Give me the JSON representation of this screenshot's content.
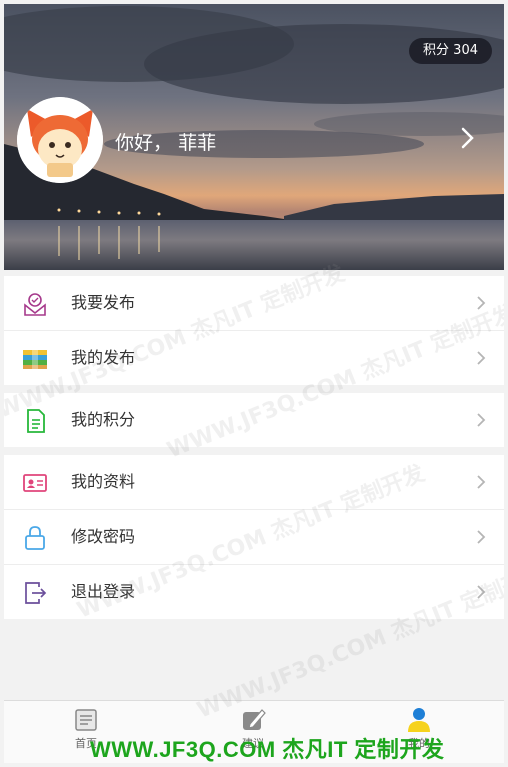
{
  "header": {
    "points_label": "积分 304",
    "greeting": "你好，",
    "username": "菲菲"
  },
  "menu_groups": [
    [
      {
        "label": "我要发布",
        "icon": "post-icon"
      },
      {
        "label": "我的发布",
        "icon": "books-icon"
      }
    ],
    [
      {
        "label": "我的积分",
        "icon": "document-icon"
      }
    ],
    [
      {
        "label": "我的资料",
        "icon": "id-card-icon"
      },
      {
        "label": "修改密码",
        "icon": "lock-icon"
      },
      {
        "label": "退出登录",
        "icon": "logout-icon"
      }
    ]
  ],
  "tabbar": {
    "home": "首页",
    "suggest": "建议",
    "mine": "我的"
  },
  "watermark": {
    "text": "WWW.JF3Q.COM 杰凡IT 定制开发",
    "bottom_text": "WWW.JF3Q.COM 杰凡IT  定制开发"
  },
  "colors": {
    "accent_green": "#1da51d",
    "text_dark": "#333333"
  }
}
